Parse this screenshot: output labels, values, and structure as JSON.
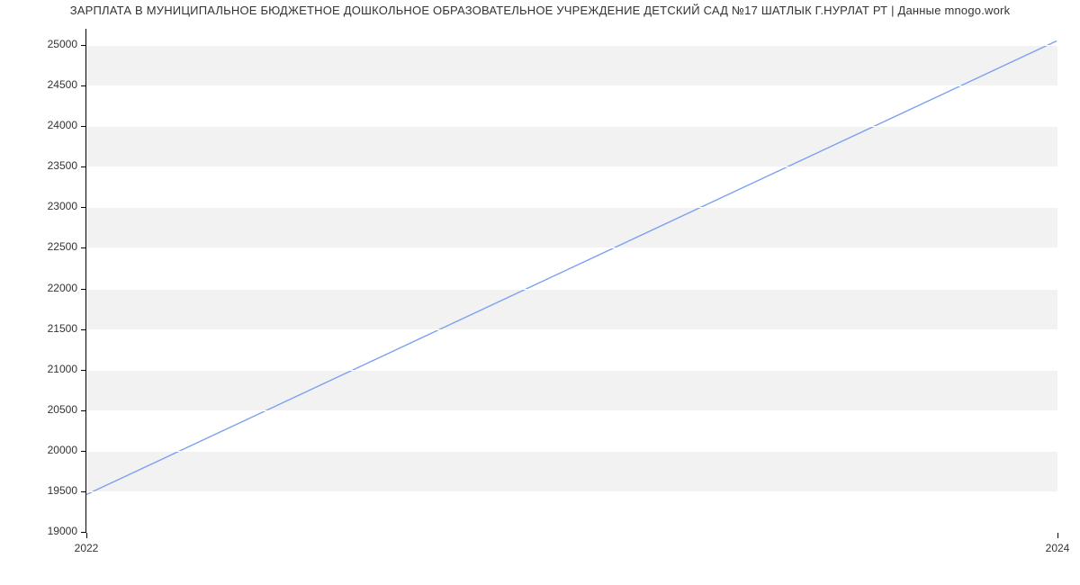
{
  "chart_data": {
    "type": "line",
    "title": "ЗАРПЛАТА В МУНИЦИПАЛЬНОЕ БЮДЖЕТНОЕ ДОШКОЛЬНОЕ ОБРАЗОВАТЕЛЬНОЕ УЧРЕЖДЕНИЕ ДЕТСКИЙ САД №17 ШАТЛЫК Г.НУРЛАТ РТ | Данные mnogo.work",
    "x": [
      2022,
      2024
    ],
    "y": [
      19450,
      25050
    ],
    "x_ticks": [
      2022,
      2024
    ],
    "y_ticks": [
      19000,
      19500,
      20000,
      20500,
      21000,
      21500,
      22000,
      22500,
      23000,
      23500,
      24000,
      24500,
      25000
    ],
    "xlabel": "",
    "ylabel": "",
    "xlim": [
      2022,
      2024
    ],
    "ylim": [
      19000,
      25200
    ],
    "line_color": "#7a9ff2"
  }
}
